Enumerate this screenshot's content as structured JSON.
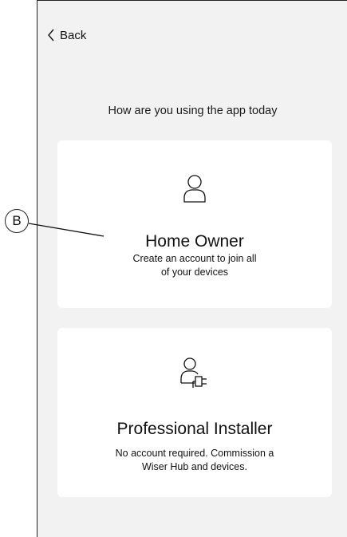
{
  "nav": {
    "back_label": "Back"
  },
  "prompt": "How are you using the app today",
  "cards": [
    {
      "title": "Home Owner",
      "description_lines": [
        "Create an account to join all",
        "of your devices"
      ],
      "icon": "person-icon"
    },
    {
      "title": "Professional Installer",
      "description_lines": [
        "No account required. Commission a",
        "Wiser Hub  and devices."
      ],
      "icon": "person-plug-icon"
    }
  ],
  "callout": {
    "label": "B"
  }
}
